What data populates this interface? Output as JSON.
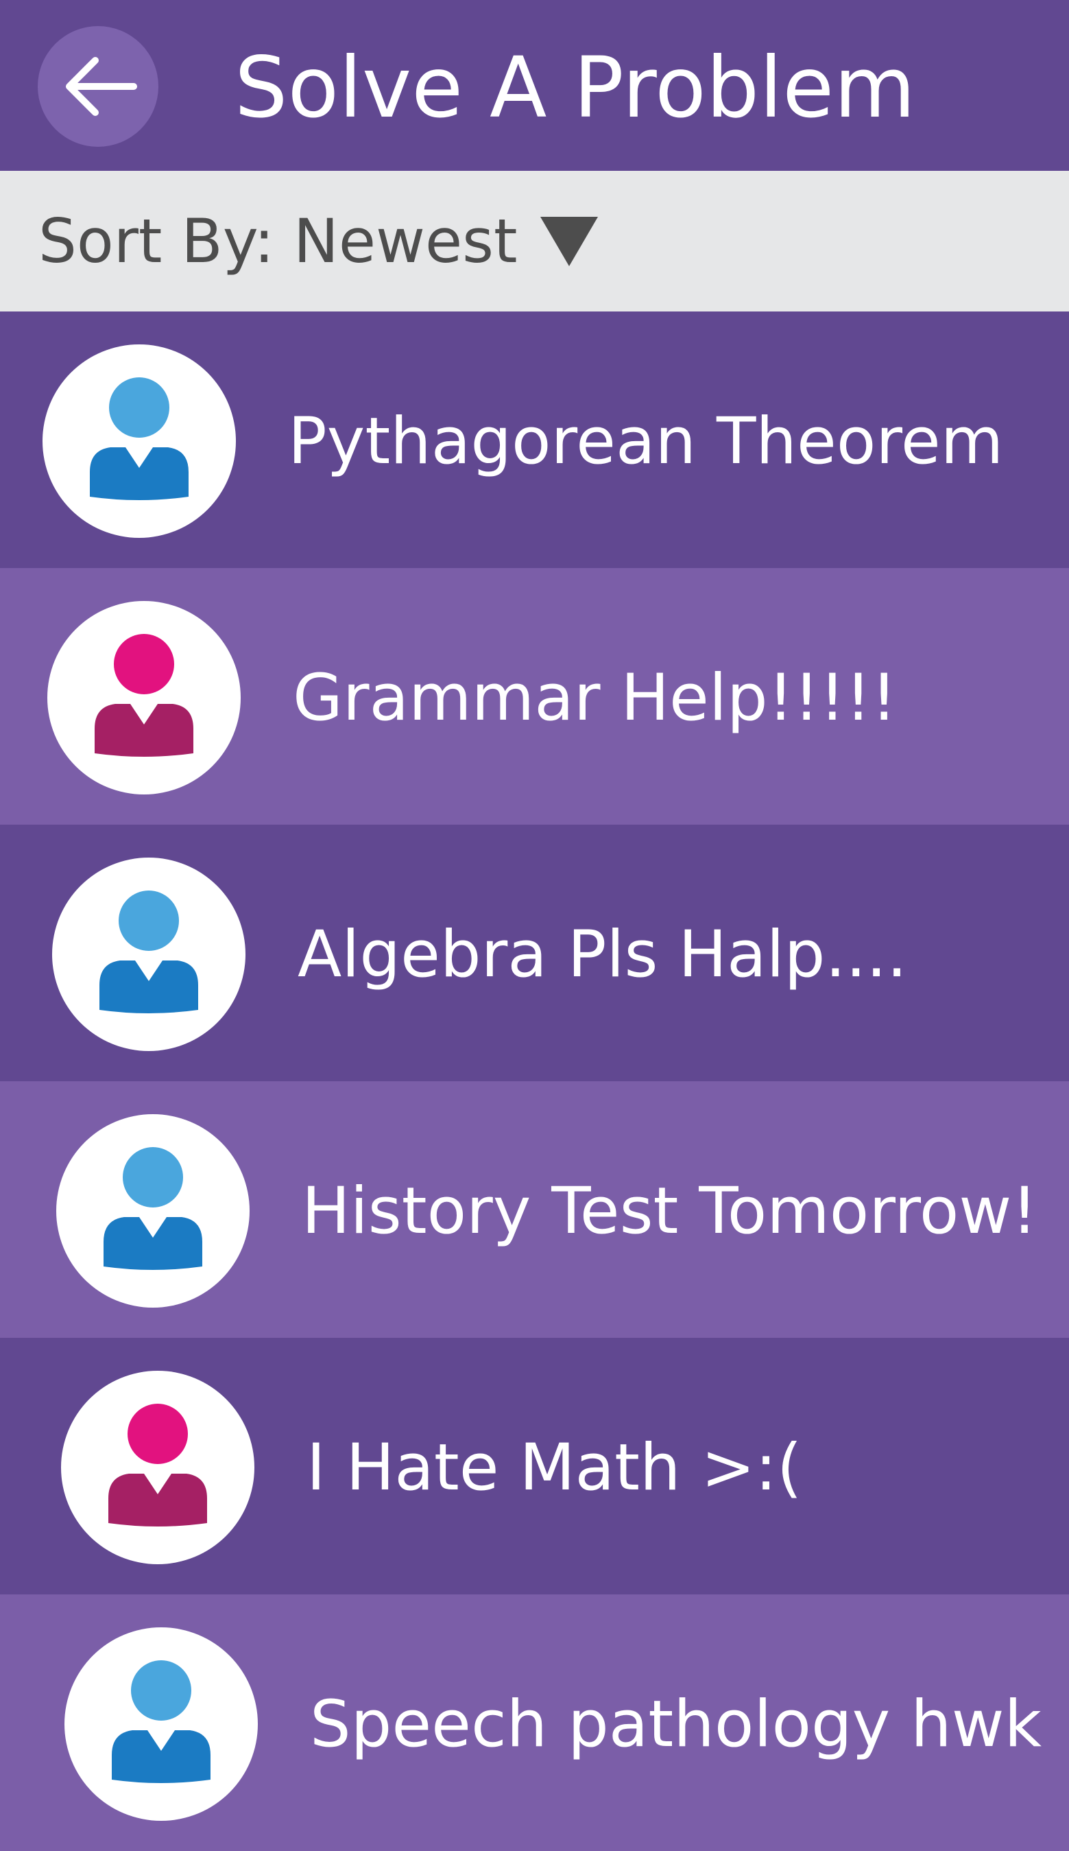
{
  "header": {
    "title": "Solve A Problem",
    "back_icon": "arrow-left-icon"
  },
  "sort": {
    "label": "Sort By: Newest",
    "icon": "triangle-down-icon"
  },
  "colors": {
    "header_bg": "#614891",
    "row_dark": "#614891",
    "row_light": "#7b5ea8",
    "sort_bar_bg": "#e6e7e8",
    "avatar_blue_head": "#4aa6dd",
    "avatar_blue_body": "#1b7bc3",
    "avatar_pink_head": "#e2127f",
    "avatar_pink_body": "#a52064"
  },
  "problems": [
    {
      "title": "Pythagorean Theorem",
      "avatar": "blue-user-icon"
    },
    {
      "title": "Grammar Help!!!!!",
      "avatar": "pink-user-icon"
    },
    {
      "title": "Algebra Pls Halp....",
      "avatar": "blue-user-icon"
    },
    {
      "title": "History Test Tomorrow!",
      "avatar": "blue-user-icon"
    },
    {
      "title": "I Hate Math >:(",
      "avatar": "pink-user-icon"
    },
    {
      "title": "Speech pathology hwk",
      "avatar": "blue-user-icon"
    }
  ]
}
